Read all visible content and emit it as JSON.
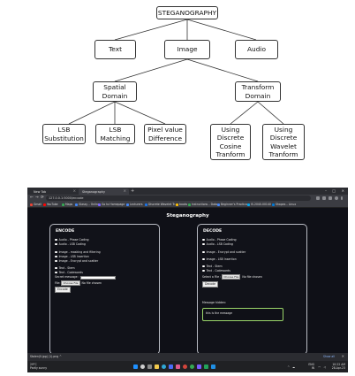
{
  "diagram": {
    "root": "STEGANOGRAPHY",
    "l1": [
      "Text",
      "Image",
      "Audio"
    ],
    "l2": [
      "Spatial\nDomain",
      "Transform\nDomain"
    ],
    "l3": [
      "LSB\nSubstitution",
      "LSB\nMatching",
      "Pixel value\nDifference",
      "Using\nDiscrete\nCosine\nTranform",
      "Using\nDiscrete\nWavelet\nTranform"
    ]
  },
  "browser": {
    "tabs": [
      "New Tab",
      "Steganography"
    ],
    "new_tab": "+",
    "window_controls": [
      "–",
      "□",
      "✕"
    ],
    "nav": [
      "←",
      "→",
      "⟳"
    ],
    "url": "127.0.0.1:5000/encode",
    "bookmarks": [
      {
        "label": "Gmail",
        "color": "#ea4335"
      },
      {
        "label": "YouTube",
        "color": "#ff0000"
      },
      {
        "label": "Maps",
        "color": "#34a853"
      },
      {
        "label": "Glassy – Online",
        "color": "#4285f4"
      },
      {
        "label": "Go to Homepage",
        "color": "#7b61ff"
      },
      {
        "label": "Lecturers",
        "color": "#4285f4"
      },
      {
        "label": "Discrete Wavelet Tr…",
        "color": "#1a73e8"
      },
      {
        "label": "books",
        "color": "#fbbc04"
      },
      {
        "label": "Instructions – Data…",
        "color": "#34a853"
      },
      {
        "label": "Beginner’s Practica…",
        "color": "#4285f4"
      },
      {
        "label": "IS-2040-00140",
        "color": "#00a4ef"
      },
      {
        "label": "Shapes – Linux",
        "color": "#0078d4"
      }
    ]
  },
  "page": {
    "title": "Steganography",
    "encode": {
      "title": "ENCODE",
      "audio_options": [
        "Audio - Phase Coding",
        "Audio - LSB Coding"
      ],
      "image_options": [
        "Image - masking and filtering",
        "Image - LSB Insertion",
        "Image - Encrypt and scatter"
      ],
      "text_options": [
        "Text - Stem",
        "Text - Codewords"
      ],
      "secret_label": "Secret message :",
      "file_label": "File:",
      "file_button": "Choose File",
      "file_status": "No file chosen",
      "action": "Encode"
    },
    "decode": {
      "title": "DECODE",
      "audio_options": [
        "Audio - Phase Coding",
        "Audio - LSB Coding"
      ],
      "image_options": [
        "Image - Encrypt and scatter",
        "Image - LSB Insertion"
      ],
      "text_options": [
        "Text - Stem",
        "Text - Codewords"
      ],
      "file_label": "Select a File :",
      "file_button": "Choose File",
      "file_status": "No file chosen",
      "action": "Decode",
      "hidden_label": "Message hidden:",
      "hidden_text": "this is the message"
    }
  },
  "downloads": {
    "item": "Stolen(0.jpg) (1).png",
    "chevron": "^",
    "show_all": "Show all",
    "close": "✕"
  },
  "taskbar": {
    "weather": "29°C\nPartly sunny",
    "tray_lang": "ENG\nIN",
    "time": "10:22 AM\n28-Apr-23"
  }
}
